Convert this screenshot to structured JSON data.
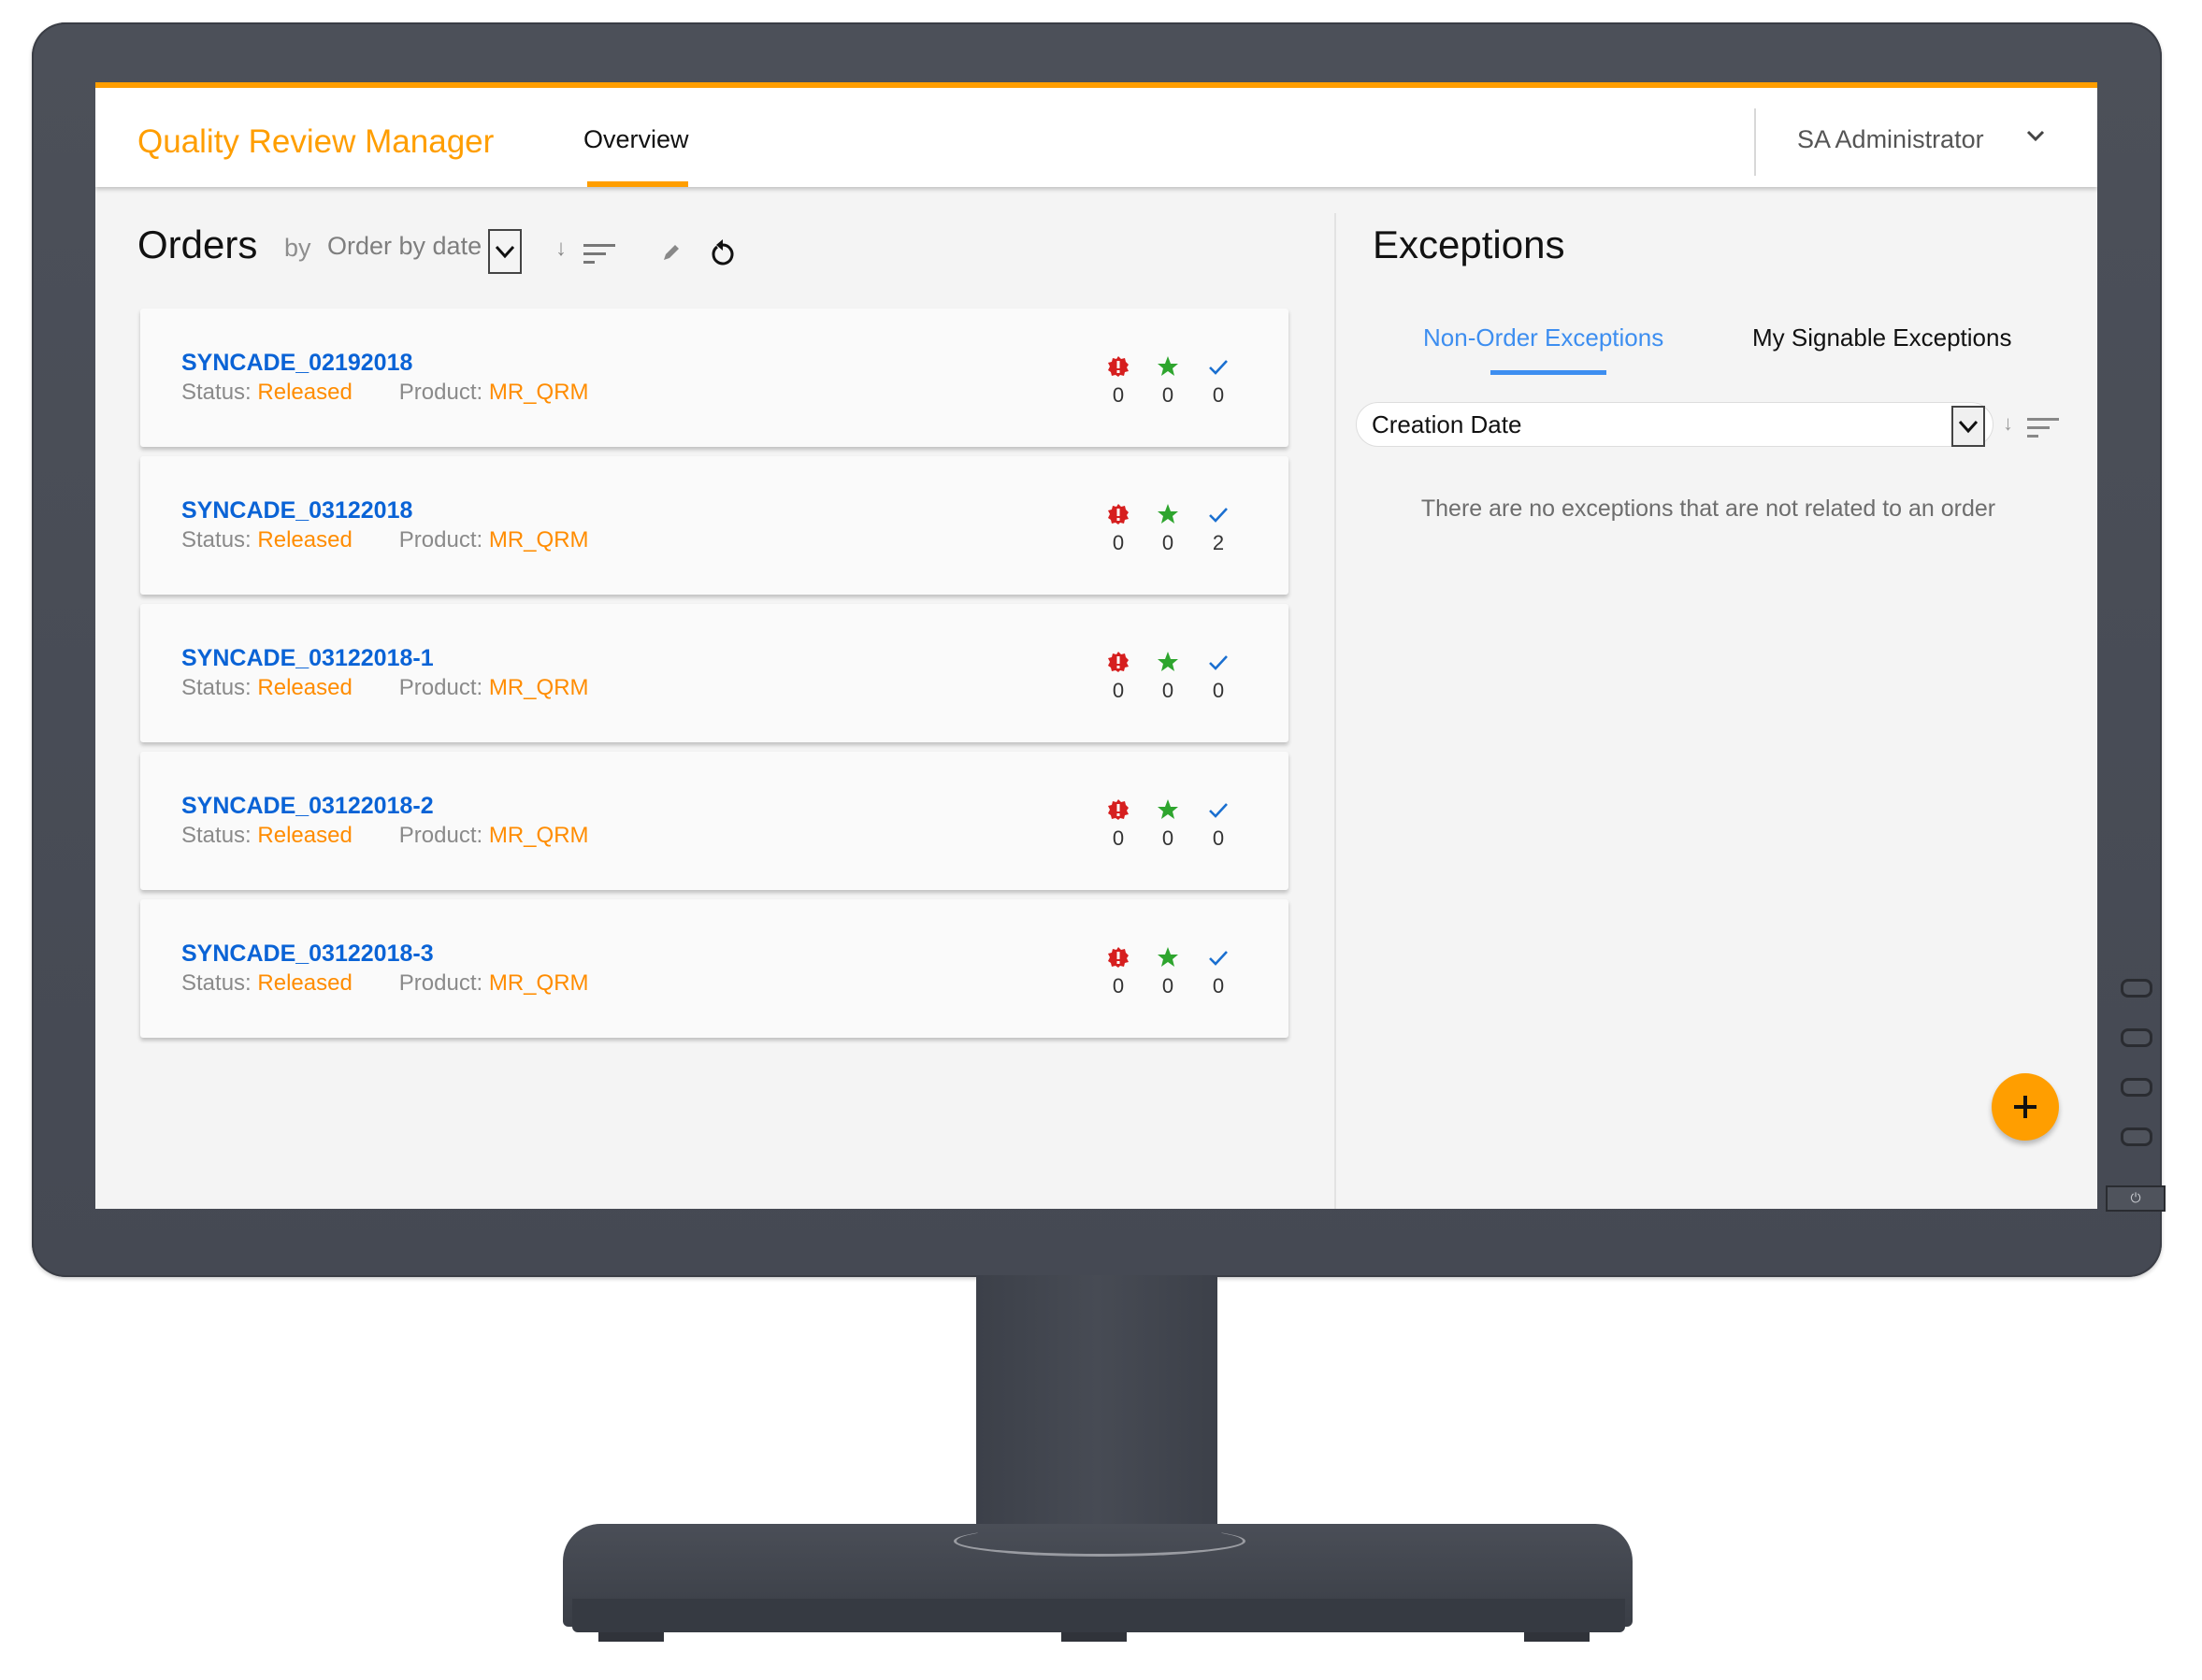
{
  "header": {
    "app_title": "Quality Review Manager",
    "nav_tabs": [
      {
        "label": "Overview",
        "active": true
      }
    ],
    "user_name": "SA Administrator",
    "accent_color": "#ff9e00"
  },
  "orders": {
    "title": "Orders",
    "by_label": "by",
    "sort_select_value": "Order by date",
    "sort_direction_icon": "arrow-down-icon",
    "items": [
      {
        "id": "SYNCADE_02192018",
        "status_label": "Status:",
        "status": "Released",
        "product_label": "Product:",
        "product": "MR_QRM",
        "counts": {
          "exceptions": "0",
          "favorites": "0",
          "approved": "0"
        }
      },
      {
        "id": "SYNCADE_03122018",
        "status_label": "Status:",
        "status": "Released",
        "product_label": "Product:",
        "product": "MR_QRM",
        "counts": {
          "exceptions": "0",
          "favorites": "0",
          "approved": "2"
        }
      },
      {
        "id": "SYNCADE_03122018-1",
        "status_label": "Status:",
        "status": "Released",
        "product_label": "Product:",
        "product": "MR_QRM",
        "counts": {
          "exceptions": "0",
          "favorites": "0",
          "approved": "0"
        }
      },
      {
        "id": "SYNCADE_03122018-2",
        "status_label": "Status:",
        "status": "Released",
        "product_label": "Product:",
        "product": "MR_QRM",
        "counts": {
          "exceptions": "0",
          "favorites": "0",
          "approved": "0"
        }
      },
      {
        "id": "SYNCADE_03122018-3",
        "status_label": "Status:",
        "status": "Released",
        "product_label": "Product:",
        "product": "MR_QRM",
        "counts": {
          "exceptions": "0",
          "favorites": "0",
          "approved": "0"
        }
      }
    ],
    "icon_colors": {
      "exception": "#d61f1f",
      "favorite": "#2ea52e",
      "approved": "#1a6fd0"
    }
  },
  "exceptions": {
    "title": "Exceptions",
    "tabs": [
      {
        "label": "Non-Order Exceptions",
        "active": true
      },
      {
        "label": "My Signable Exceptions",
        "active": false
      }
    ],
    "sort_select_value": "Creation Date",
    "empty_message": "There are no exceptions that are not related to an order",
    "fab_label": "+"
  },
  "device": {
    "power_glyph": "⏻"
  }
}
